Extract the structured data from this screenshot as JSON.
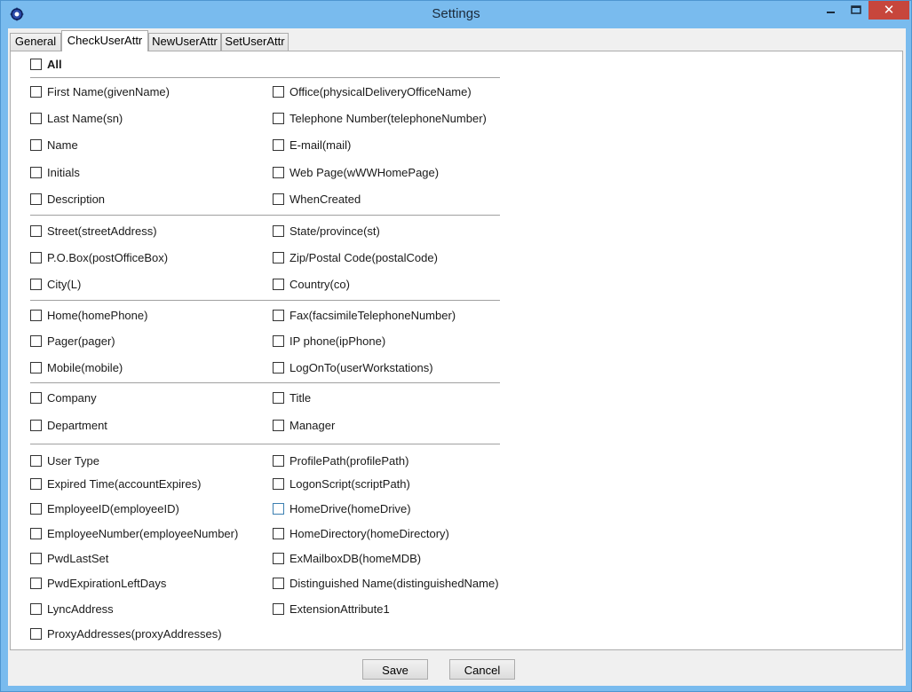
{
  "window": {
    "title": "Settings",
    "close_glyph": "✕"
  },
  "tabs": [
    {
      "label": "General"
    },
    {
      "label": "CheckUserAttr"
    },
    {
      "label": "NewUserAttr"
    },
    {
      "label": "SetUserAttr"
    }
  ],
  "active_tab": "CheckUserAttr",
  "all_label": "All",
  "checkboxes": [
    "First Name(givenName)",
    "Office(physicalDeliveryOfficeName)",
    "Last Name(sn)",
    "Telephone Number(telephoneNumber)",
    "Name",
    "E-mail(mail)",
    "Initials",
    "Web Page(wWWHomePage)",
    "Description",
    "WhenCreated",
    "Street(streetAddress)",
    "State/province(st)",
    "P.O.Box(postOfficeBox)",
    "Zip/Postal Code(postalCode)",
    "City(L)",
    "Country(co)",
    "Home(homePhone)",
    "Fax(facsimileTelephoneNumber)",
    "Pager(pager)",
    "IP phone(ipPhone)",
    "Mobile(mobile)",
    "LogOnTo(userWorkstations)",
    "Company",
    "Title",
    "Department",
    "Manager",
    "User Type",
    "ProfilePath(profilePath)",
    "Expired Time(accountExpires)",
    "LogonScript(scriptPath)",
    "EmployeeID(employeeID)",
    "HomeDrive(homeDrive)",
    "EmployeeNumber(employeeNumber)",
    "HomeDirectory(homeDirectory)",
    "PwdLastSet",
    "ExMailboxDB(homeMDB)",
    "PwdExpirationLeftDays",
    "Distinguished Name(distinguishedName)",
    "LyncAddress",
    "ExtensionAttribute1",
    "ProxyAddresses(proxyAddresses)"
  ],
  "buttons": {
    "save": "Save",
    "cancel": "Cancel"
  },
  "colors": {
    "frame": "#79bbee",
    "close_button": "#c7463c",
    "focus_checkbox": "#3c7fb1"
  }
}
